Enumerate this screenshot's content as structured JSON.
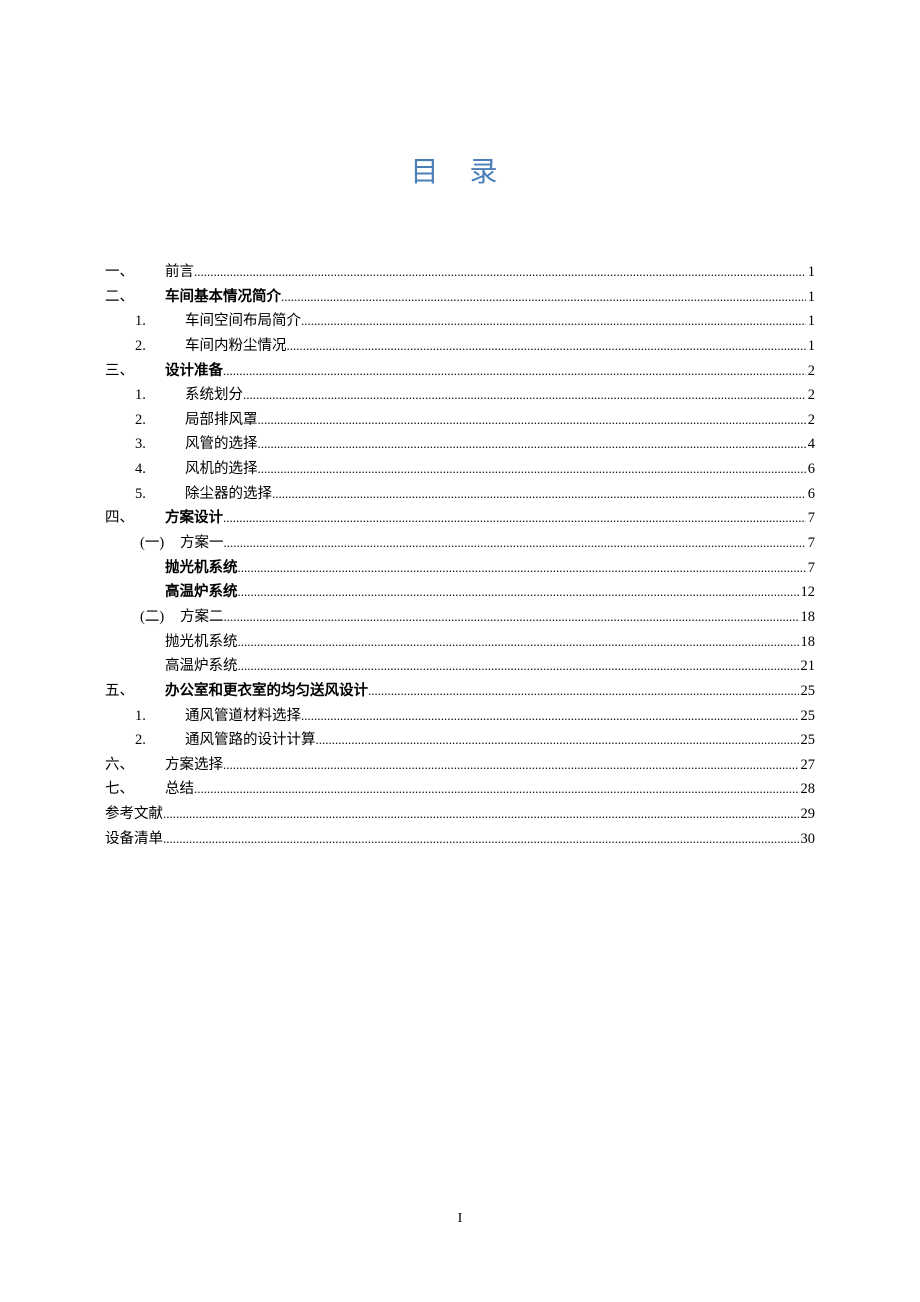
{
  "title": "目 录",
  "page_number": "I",
  "toc": [
    {
      "level": 1,
      "num": "一、",
      "label": "前言",
      "page": "1",
      "bold": false
    },
    {
      "level": 1,
      "num": "二、",
      "label": "车间基本情况简介",
      "page": "1",
      "bold": true
    },
    {
      "level": 2,
      "num": "1.",
      "label": "车间空间布局简介",
      "page": "1",
      "bold": false
    },
    {
      "level": 2,
      "num": "2.",
      "label": "车间内粉尘情况",
      "page": "1",
      "bold": false
    },
    {
      "level": 1,
      "num": "三、",
      "label": "设计准备",
      "page": "2",
      "bold": true
    },
    {
      "level": 2,
      "num": "1.",
      "label": "系统划分",
      "page": "2",
      "bold": false
    },
    {
      "level": 2,
      "num": "2.",
      "label": "局部排风罩",
      "page": "2",
      "bold": false
    },
    {
      "level": 2,
      "num": "3.",
      "label": "风管的选择",
      "page": "4",
      "bold": false
    },
    {
      "level": 2,
      "num": "4.",
      "label": "风机的选择",
      "page": "6",
      "bold": false
    },
    {
      "level": 2,
      "num": "5.",
      "label": "除尘器的选择",
      "page": "6",
      "bold": false
    },
    {
      "level": 1,
      "num": "四、",
      "label": "方案设计",
      "page": "7",
      "bold": true
    },
    {
      "level": 3,
      "num": "(一)",
      "label": "方案一",
      "page": "7",
      "bold": false
    },
    {
      "level": 4,
      "num": "",
      "label": "抛光机系统",
      "page": "7",
      "bold": true
    },
    {
      "level": 4,
      "num": "",
      "label": "高温炉系统",
      "page": "12",
      "bold": true
    },
    {
      "level": 3,
      "num": "(二)",
      "label": "方案二",
      "page": "18",
      "bold": false
    },
    {
      "level": 4,
      "num": "",
      "label": "抛光机系统",
      "page": "18",
      "bold": false
    },
    {
      "level": 4,
      "num": "",
      "label": "高温炉系统",
      "page": "21",
      "bold": false
    },
    {
      "level": 1,
      "num": "五、",
      "label": "办公室和更衣室的均匀送风设计",
      "page": "25",
      "bold": true
    },
    {
      "level": 2,
      "num": "1.",
      "label": "通风管道材料选择",
      "page": "25",
      "bold": false
    },
    {
      "level": 2,
      "num": "2.",
      "label": "通风管路的设计计算",
      "page": "25",
      "bold": false
    },
    {
      "level": 1,
      "num": "六、",
      "label": "方案选择",
      "page": "27",
      "bold": false
    },
    {
      "level": 1,
      "num": "七、",
      "label": "总结",
      "page": "28",
      "bold": false
    },
    {
      "level": 0,
      "num": "",
      "label": "参考文献",
      "page": "29",
      "bold": false
    },
    {
      "level": 0,
      "num": "",
      "label": "设备清单",
      "page": "30",
      "bold": false
    }
  ]
}
